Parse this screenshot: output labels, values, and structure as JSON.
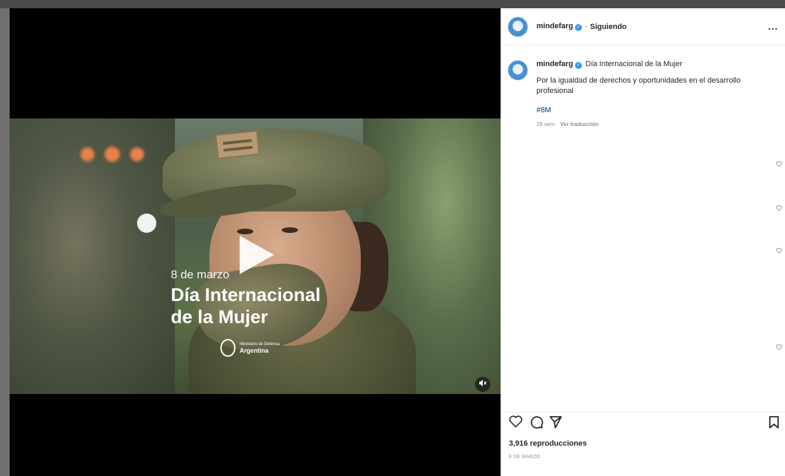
{
  "video": {
    "date_text": "8 de marzo",
    "title_line1": "Día Internacional",
    "title_line2": "de la Mujer",
    "logo_line1": "Ministerio de Defensa",
    "logo_line2": "Argentina",
    "mute_icon": "speaker-muted-icon"
  },
  "header": {
    "username": "mindefarg",
    "separator": "·",
    "follow_status": "Siguiendo",
    "more": "..."
  },
  "caption": {
    "username": "mindefarg",
    "headline": "Día Internacional de la Mujer",
    "text": "Por la igualdad de derechos y oportunidades en el desarrollo profesional",
    "hashtag": "#8M",
    "age": "29 sem",
    "translate": "Ver traducción"
  },
  "stats": {
    "views": "3,916 reproducciones",
    "date": "8 DE MARZO"
  },
  "colors": {
    "accent_link": "#00376b",
    "verified_blue": "#3897f0"
  }
}
